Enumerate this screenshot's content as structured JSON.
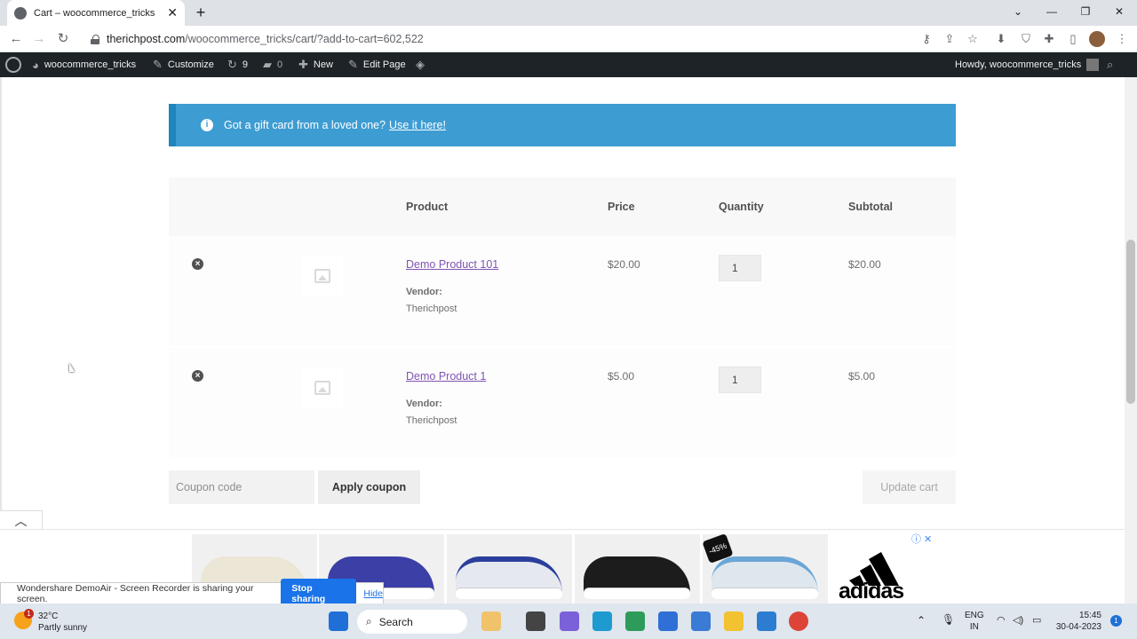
{
  "browser": {
    "tab_title": "Cart – woocommerce_tricks",
    "url_host": "therichpost.com",
    "url_path": "/woocommerce_tricks/cart/?add-to-cart=602,522"
  },
  "admin_bar": {
    "site_name": "woocommerce_tricks",
    "customize": "Customize",
    "updates_count": "9",
    "comments_count": "0",
    "new_label": "New",
    "edit_page": "Edit Page",
    "howdy": "Howdy, woocommerce_tricks"
  },
  "notice": {
    "text": "Got a gift card from a loved one?",
    "link": "Use it here!"
  },
  "table": {
    "headers": {
      "product": "Product",
      "price": "Price",
      "quantity": "Quantity",
      "subtotal": "Subtotal"
    },
    "rows": [
      {
        "name": "Demo Product 101",
        "vendor_label": "Vendor:",
        "vendor": "Therichpost",
        "price": "$20.00",
        "qty": "1",
        "subtotal": "$20.00"
      },
      {
        "name": "Demo Product 1",
        "vendor_label": "Vendor:",
        "vendor": "Therichpost",
        "price": "$5.00",
        "qty": "1",
        "subtotal": "$5.00"
      }
    ]
  },
  "actions": {
    "coupon_placeholder": "Coupon code",
    "apply_coupon": "Apply coupon",
    "update_cart": "Update cart"
  },
  "ad": {
    "discount": "-45%",
    "brand": "adidas"
  },
  "share_bar": {
    "text": "Wondershare DemoAir - Screen Recorder is sharing your screen.",
    "stop": "Stop sharing",
    "hide": "Hide"
  },
  "taskbar": {
    "weather_temp": "32°C",
    "weather_desc": "Partly sunny",
    "weather_badge": "1",
    "search": "Search",
    "lang1": "ENG",
    "lang2": "IN",
    "time": "15:45",
    "date": "30-04-2023",
    "notif": "1"
  },
  "colors": {
    "notice_bg": "#3d9cd2",
    "admin_bar": "#1d2327",
    "product_link": "#7f54b3",
    "stop_button": "#1a73e8"
  }
}
